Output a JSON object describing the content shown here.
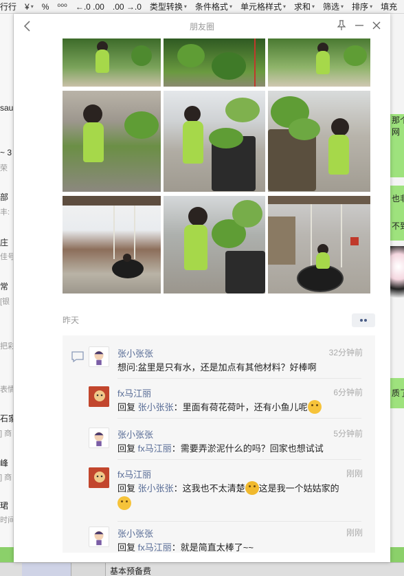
{
  "toolbar": {
    "items": [
      {
        "label": "行行",
        "caret": ""
      },
      {
        "label": "¥",
        "caret": "▾"
      },
      {
        "label": "%",
        "caret": ""
      },
      {
        "label": "⁰⁰⁰",
        "caret": ""
      },
      {
        "label": "←.0 .00",
        "caret": ""
      },
      {
        "label": ".00 →.0",
        "caret": ""
      },
      {
        "label": "类型转换",
        "caret": "▾"
      },
      {
        "label": "条件格式",
        "caret": "▾"
      },
      {
        "label": "单元格样式",
        "caret": "▾"
      },
      {
        "label": "求和",
        "caret": "▾"
      },
      {
        "label": "筛选",
        "caret": "▾"
      },
      {
        "label": "排序",
        "caret": "▾"
      },
      {
        "label": "填充",
        "caret": ""
      }
    ]
  },
  "background": {
    "left_fragments": [
      "sau",
      "~ 3",
      "荣",
      "部",
      "丰:",
      "庄",
      "佳号",
      "常",
      "[银",
      "把彩",
      "表情",
      "石家",
      "] 商",
      "峰",
      "] 商",
      "珺",
      "时间"
    ],
    "right_fragments": [
      "那个",
      "网",
      "也非",
      "不到",
      "质了"
    ],
    "bottom_label": "基本预备费"
  },
  "window": {
    "title": "朋友圈"
  },
  "post": {
    "time": "昨天",
    "photo_count": 9
  },
  "comments": [
    {
      "name": "张小张张",
      "time": "32分钟前",
      "text": "想问:盆里是只有水，还是加点有其他材料？好棒啊",
      "reply_prefix": "",
      "reply_to": "",
      "avatar": "cartoon-avatar"
    },
    {
      "name": "fx马江丽",
      "time": "6分钟前",
      "reply_prefix": "回复",
      "reply_to": "张小张张",
      "text": "：里面有荷花荷叶，还有小鱼儿呢",
      "emoji": "thinking-emoji",
      "avatar": "red-avatar"
    },
    {
      "name": "张小张张",
      "time": "5分钟前",
      "reply_prefix": "回复",
      "reply_to": "fx马江丽",
      "text": "：需要弄淤泥什么的吗？回家也想试试",
      "avatar": "cartoon-avatar"
    },
    {
      "name": "fx马江丽",
      "time": "刚刚",
      "reply_prefix": "回复",
      "reply_to": "张小张张",
      "text": "：这我也不太清楚",
      "text2": "这是我一个姑姑家的",
      "emoji": "laughing-crying-emoji",
      "emoji2": "thinking-emoji",
      "avatar": "red-avatar"
    },
    {
      "name": "张小张张",
      "time": "刚刚",
      "reply_prefix": "回复",
      "reply_to": "fx马江丽",
      "text": "：就是简直太棒了~~",
      "avatar": "cartoon-avatar"
    }
  ],
  "colors": {
    "link": "#576b95",
    "comment_bg": "#f6f6f6",
    "accent_green": "#9ee27d"
  }
}
